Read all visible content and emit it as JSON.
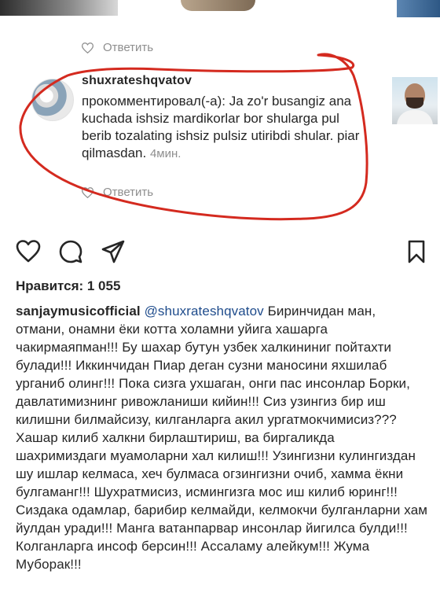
{
  "top_reply": {
    "label": "Ответить"
  },
  "comment": {
    "username": "shuxrateshqvatov",
    "text": "прокомментировал(-а): Ja zo'r busangiz ana kuchada ishsiz mardikorlar bor shularga pul berib tozalating ishsiz pulsiz utiribdi shular. piar qilmasdan.",
    "time": "4мин.",
    "reply_label": "Ответить"
  },
  "post": {
    "likes": "Нравится: 1 055",
    "caption_author": "sanjaymusicofficial",
    "caption_mention": "@shuxrateshqvatov",
    "caption_text": "Биринчидан ман, отмани, онамни ёки котта холамни уйига хашарга чакирмаяпман!!! Бу шахар бутун узбек халкининиг пойтахти булади!!! Иккинчидан Пиар деган сузни маносини яхшилаб урганиб олинг!!! Пока сизга ухшаган, онги пас инсонлар Борки, давлатимизнинг ривожланиши кийин!!! Сиз узингиз бир иш килишни билмайсизу, килганларга акил ургатмокчимисиз??? Хашар килиб халкни бирлаштириш, ва биргаликда шахримиздаги муамоларни хал килиш!!! Узингизни кулингиздан шу ишлар келмаса, хеч булмаса огзингизни очиб, хамма ёкни булгаманг!!! Шухратмисиз, исмингизга мос иш килиб юринг!!! Сиздака одамлар, барибир келмайди, келмокчи булганларни хам йулдан уради!!! Манга ватанпарвар инсонлар йигилса булди!!! Колганларга инсоф берсин!!! Ассаламу алейкум!!! Жума Муборак!!!"
  },
  "icons": [
    "heart-icon",
    "comment-icon",
    "share-icon",
    "bookmark-icon"
  ],
  "colors": {
    "annotation": "#d42a1f",
    "muted": "#8e8e8e",
    "mention": "#1f4c8c"
  }
}
